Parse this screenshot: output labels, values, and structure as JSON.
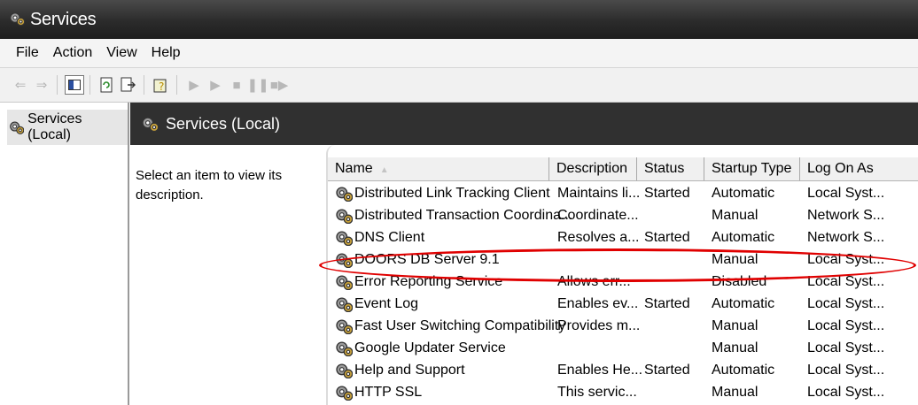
{
  "window": {
    "title": "Services"
  },
  "menu": [
    "File",
    "Action",
    "View",
    "Help"
  ],
  "toolbar": {
    "icons": [
      "back-arrow-icon",
      "forward-arrow-icon",
      "show-hide-console-tree-icon",
      "refresh-icon",
      "export-list-icon",
      "properties-help-icon",
      "start-service-icon",
      "play-service-icon",
      "stop-service-icon",
      "pause-service-icon",
      "restart-service-icon"
    ]
  },
  "tree": {
    "root_label": "Services (Local)"
  },
  "panel": {
    "title": "Services (Local)"
  },
  "description": {
    "text": "Select an item to view its description."
  },
  "columns": [
    {
      "label": "Name"
    },
    {
      "label": "Description"
    },
    {
      "label": "Status"
    },
    {
      "label": "Startup Type"
    },
    {
      "label": "Log On As"
    }
  ],
  "services": [
    {
      "name": "Distributed Link Tracking Client",
      "description": "Maintains li...",
      "status": "Started",
      "startup": "Automatic",
      "logon": "Local Syst..."
    },
    {
      "name": "Distributed Transaction Coordina...",
      "description": "Coordinate...",
      "status": "",
      "startup": "Manual",
      "logon": "Network S..."
    },
    {
      "name": "DNS Client",
      "description": "Resolves a...",
      "status": "Started",
      "startup": "Automatic",
      "logon": "Network S..."
    },
    {
      "name": "DOORS DB Server 9.1",
      "description": "",
      "status": "",
      "startup": "Manual",
      "logon": "Local Syst..."
    },
    {
      "name": "Error Reporting Service",
      "description": "Allows err...",
      "status": "",
      "startup": "Disabled",
      "logon": "Local Syst..."
    },
    {
      "name": "Event Log",
      "description": "Enables ev...",
      "status": "Started",
      "startup": "Automatic",
      "logon": "Local Syst..."
    },
    {
      "name": "Fast User Switching Compatibility",
      "description": "Provides m...",
      "status": "",
      "startup": "Manual",
      "logon": "Local Syst..."
    },
    {
      "name": "Google Updater Service",
      "description": "",
      "status": "",
      "startup": "Manual",
      "logon": "Local Syst..."
    },
    {
      "name": "Help and Support",
      "description": "Enables He...",
      "status": "Started",
      "startup": "Automatic",
      "logon": "Local Syst..."
    },
    {
      "name": "HTTP SSL",
      "description": "This servic...",
      "status": "",
      "startup": "Manual",
      "logon": "Local Syst..."
    }
  ],
  "colors": {
    "highlight": "#e00000",
    "titlebar": "#2b2b2b"
  }
}
